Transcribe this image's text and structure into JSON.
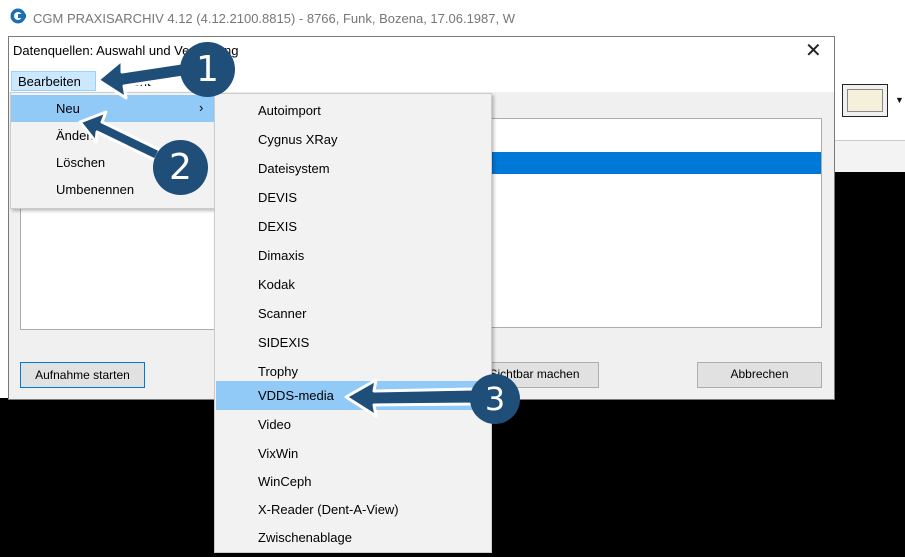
{
  "main_window": {
    "title": "CGM PRAXISARCHIV 4.12 (4.12.2100.8815) - 8766, Funk, Bozena, 17.06.1987, W",
    "app_icon": "cgm-logo-icon"
  },
  "dialog": {
    "title": "Datenquellen: Auswahl und Verwaltung",
    "close_label": "✕",
    "menubar": [
      "Bearbeiten",
      "Ansicht"
    ],
    "buttons": {
      "start": "Aufnahme starten",
      "visible": "Sichtbar machen",
      "cancel": "Abbrechen"
    }
  },
  "context_menu": {
    "items": [
      "Neu",
      "Ändern",
      "Löschen",
      "Umbenennen"
    ],
    "submenu_indicator": "›"
  },
  "submenu": {
    "items": [
      "Autoimport",
      "Cygnus XRay",
      "Dateisystem",
      "DEVIS",
      "DEXIS",
      "Dimaxis",
      "Kodak",
      "Scanner",
      "SIDEXIS",
      "Trophy",
      "VDDS-media",
      "Video",
      "VixWin",
      "WinCeph",
      "X-Reader (Dent-A-View)",
      "Zwischenablage"
    ],
    "highlighted": "VDDS-media"
  },
  "annotations": {
    "badges": [
      "1",
      "2",
      "3"
    ],
    "color": "#1f4e79"
  },
  "colors": {
    "hover": "#91c9f7",
    "selection": "#0078d7",
    "menu_bg": "#f2f2f2"
  }
}
